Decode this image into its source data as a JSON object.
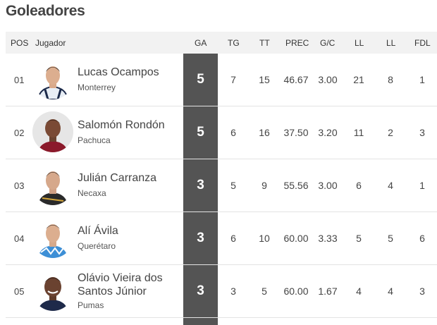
{
  "title": "Goleadores",
  "columns": [
    "POS",
    "Jugador",
    "GA",
    "TG",
    "TT",
    "PREC",
    "G/C",
    "LL",
    "LL",
    "FDL"
  ],
  "rows": [
    {
      "pos": "01",
      "name": "Lucas Ocampos",
      "team": "Monterrey",
      "ga": "5",
      "tg": "7",
      "tt": "15",
      "prec": "46.67",
      "gc": "3.00",
      "ll1": "21",
      "ll2": "8",
      "fdl": "1",
      "kit": "#e8eef5"
    },
    {
      "pos": "02",
      "name": "Salomón Rondón",
      "team": "Pachuca",
      "ga": "5",
      "tg": "6",
      "tt": "16",
      "prec": "37.50",
      "gc": "3.20",
      "ll1": "11",
      "ll2": "2",
      "fdl": "3",
      "kit": "#8b1a2b"
    },
    {
      "pos": "03",
      "name": "Julián Carranza",
      "team": "Necaxa",
      "ga": "3",
      "tg": "5",
      "tt": "9",
      "prec": "55.56",
      "gc": "3.00",
      "ll1": "6",
      "ll2": "4",
      "fdl": "1",
      "kit": "#2a2a2a"
    },
    {
      "pos": "04",
      "name": "Alí Ávila",
      "team": "Querétaro",
      "ga": "3",
      "tg": "6",
      "tt": "10",
      "prec": "60.00",
      "gc": "3.33",
      "ll1": "5",
      "ll2": "5",
      "fdl": "6",
      "kit": "#3d8fd6"
    },
    {
      "pos": "05",
      "name_line1": "Olávio Vieira dos",
      "name_line2": "Santos Júnior",
      "team": "Pumas",
      "ga": "3",
      "tg": "3",
      "tt": "5",
      "prec": "60.00",
      "gc": "1.67",
      "ll1": "4",
      "ll2": "4",
      "fdl": "3",
      "kit": "#1e2a4a"
    }
  ]
}
